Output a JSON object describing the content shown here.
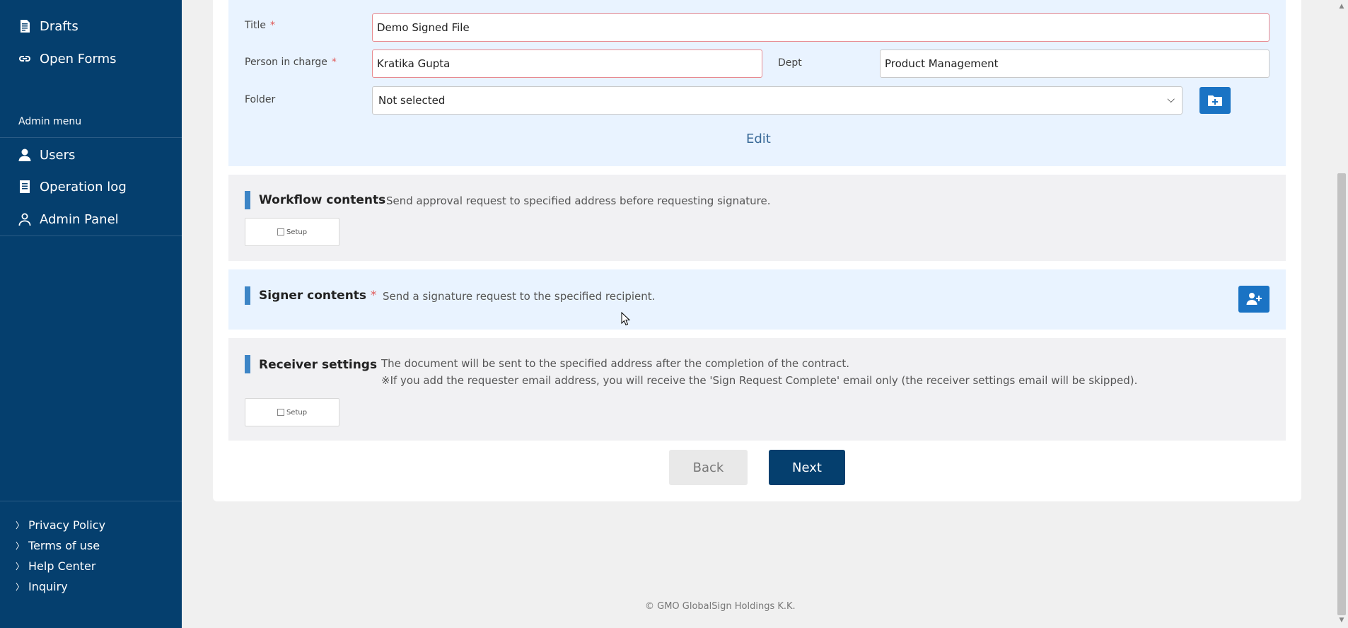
{
  "sidebar": {
    "items": [
      {
        "label": "Drafts",
        "icon": "document-icon"
      },
      {
        "label": "Open Forms",
        "icon": "link-icon"
      }
    ],
    "admin_label": "Admin menu",
    "admin_items": [
      {
        "label": "Users",
        "icon": "user-icon"
      },
      {
        "label": "Operation log",
        "icon": "log-icon"
      },
      {
        "label": "Admin Panel",
        "icon": "admin-icon"
      }
    ],
    "footer_links": [
      {
        "label": "Privacy Policy"
      },
      {
        "label": "Terms of use"
      },
      {
        "label": "Help Center"
      },
      {
        "label": "Inquiry"
      }
    ]
  },
  "form": {
    "title_label": "Title",
    "title_value": "Demo Signed File",
    "person_label": "Person in charge",
    "person_value": "Kratika Gupta",
    "dept_label": "Dept",
    "dept_value": "Product Management",
    "folder_label": "Folder",
    "folder_value": "Not selected",
    "required_mark": "*",
    "edit_label": "Edit"
  },
  "workflow": {
    "title": "Workflow contents",
    "desc": "Send approval request to specified address before requesting signature.",
    "setup_label": "Setup"
  },
  "signer": {
    "title": "Signer contents",
    "required_mark": "*",
    "desc": "Send a signature request to the specified recipient."
  },
  "receiver": {
    "title": "Receiver settings",
    "desc_line1": "The document will be sent to the specified address after the completion of the contract.",
    "desc_line2": "※If you add the requester email address, you will receive the 'Sign Request Complete' email only (the receiver settings email will be skipped).",
    "setup_label": "Setup"
  },
  "actions": {
    "back_label": "Back",
    "next_label": "Next"
  },
  "footer": {
    "copyright": "© GMO GlobalSign Holdings K.K."
  },
  "colors": {
    "sidebar_bg": "#053f6e",
    "accent": "#1a73c4",
    "required": "#e05a5a"
  }
}
